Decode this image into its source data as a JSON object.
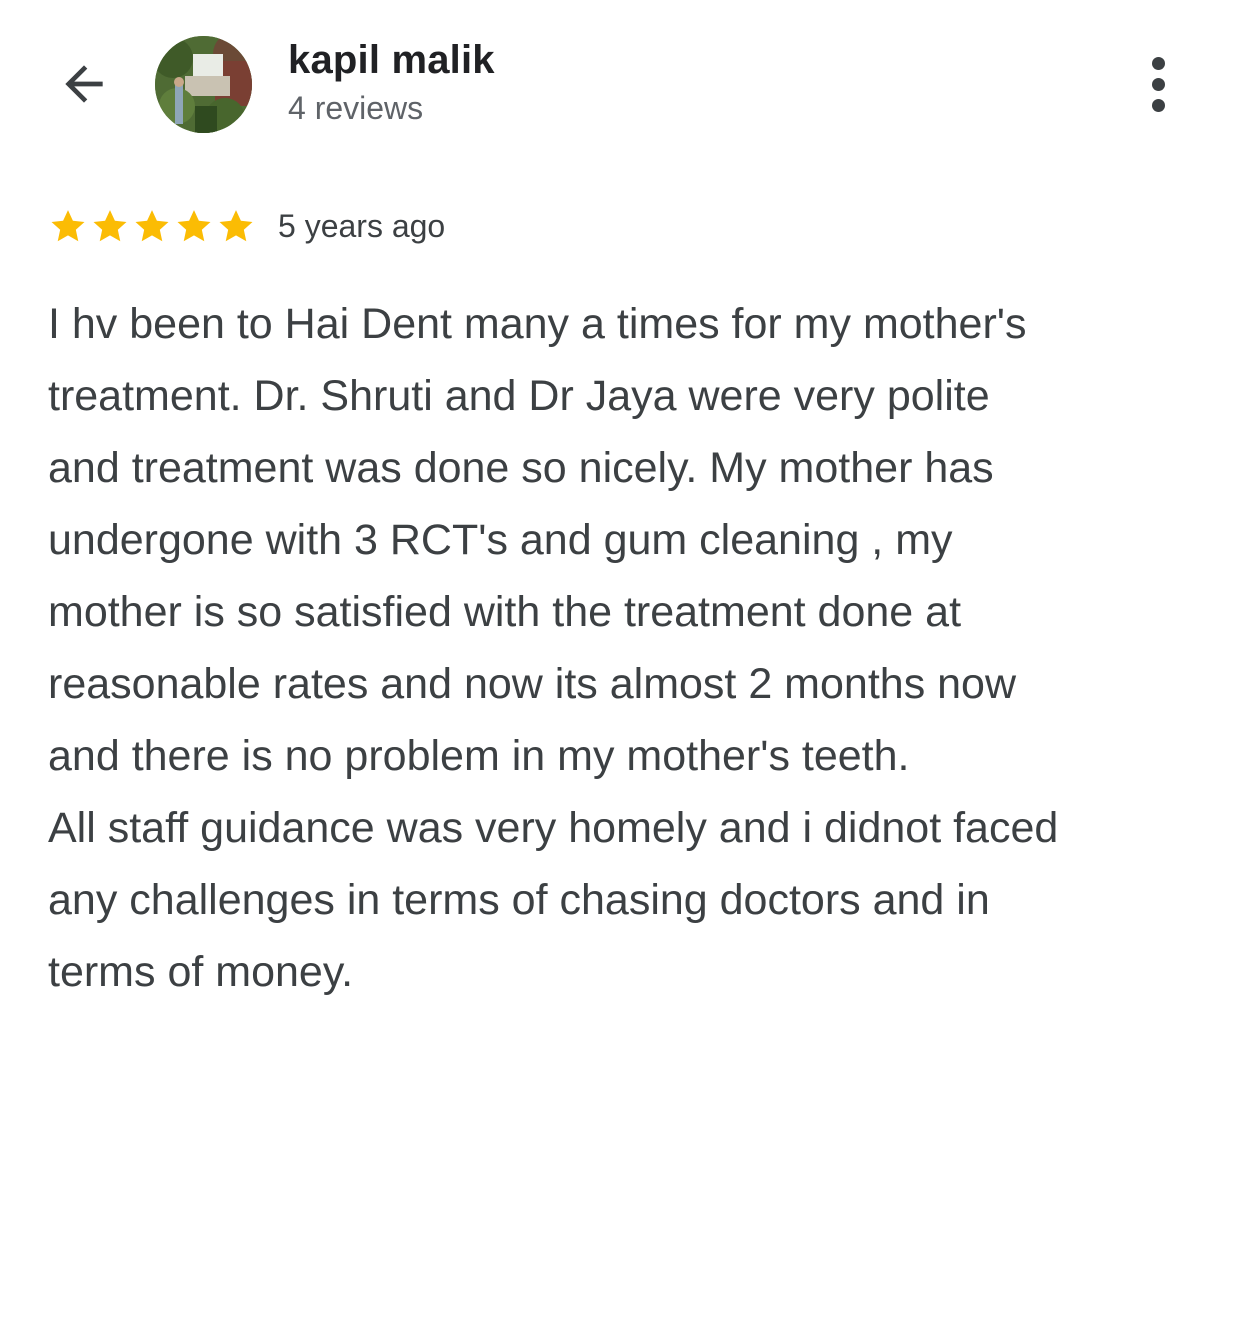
{
  "header": {
    "back_icon": "arrow-left-icon",
    "reviewer_name": "kapil malik",
    "review_count": "4 reviews",
    "more_icon": "more-vert-icon"
  },
  "review": {
    "rating": 5,
    "rating_max": 5,
    "star_color": "#fbbc04",
    "time_ago": "5 years ago",
    "lines": [
      "I hv been to Hai Dent many a times for my mother's",
      "treatment. Dr. Shruti and Dr Jaya were very polite",
      "and treatment was done so nicely. My mother has",
      "undergone with 3 RCT's and gum cleaning , my",
      "mother is so satisfied with the treatment done at",
      "reasonable rates and now its almost 2 months now",
      "and there is no problem in my mother's teeth.",
      "All staff guidance was very homely and i didnot faced",
      "any challenges in terms of chasing doctors and in",
      "terms of money."
    ]
  }
}
